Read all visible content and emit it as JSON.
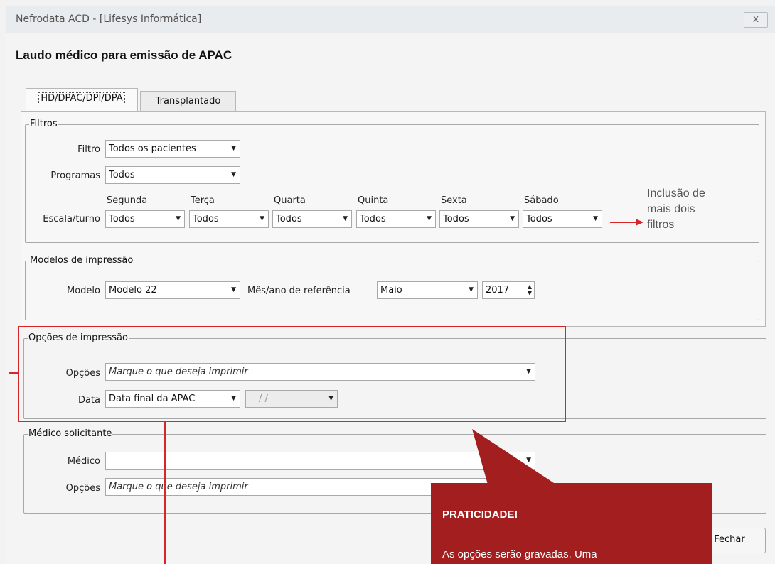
{
  "window": {
    "title": "Nefrodata ACD - [Lifesys Informática]",
    "close_glyph": "x"
  },
  "page_title": "Laudo médico para emissão de APAC",
  "tabs": [
    {
      "label": "HD/DPAC/DPI/DPA",
      "active": true
    },
    {
      "label": "Transplantado",
      "active": false
    }
  ],
  "filtros": {
    "legend": "Filtros",
    "filtro_label": "Filtro",
    "filtro_value": "Todos os pacientes",
    "programas_label": "Programas",
    "programas_value": "Todos",
    "escala_label": "Escala/turno",
    "days": [
      {
        "label": "Segunda",
        "value": "Todos"
      },
      {
        "label": "Terça",
        "value": "Todos"
      },
      {
        "label": "Quarta",
        "value": "Todos"
      },
      {
        "label": "Quinta",
        "value": "Todos"
      },
      {
        "label": "Sexta",
        "value": "Todos"
      },
      {
        "label": "Sábado",
        "value": "Todos"
      }
    ]
  },
  "modelos": {
    "legend": "Modelos de impressão",
    "modelo_label": "Modelo",
    "modelo_value": "Modelo 22",
    "mes_ano_label": "Mês/ano de referência",
    "mes_value": "Maio",
    "ano_value": "2017"
  },
  "opcoes_impressao": {
    "legend": "Opções de impressão",
    "opcoes_label": "Opções",
    "opcoes_placeholder": "Marque o que deseja imprimir",
    "data_label": "Data",
    "data_value": "Data final da APAC",
    "date_value": "/ /"
  },
  "medico_solicitante": {
    "legend": "Médico solicitante",
    "medico_label": "Médico",
    "medico_value": "",
    "opcoes_label": "Opções",
    "opcoes_placeholder": "Marque o que deseja imprimir"
  },
  "annotation": {
    "text_lines": [
      "Inclusão de",
      "mais dois",
      "filtros"
    ],
    "color": "#d9252a"
  },
  "callout": {
    "title": "PRATICIDADE!",
    "body": "As opções serão gravadas. Uma",
    "color": "#a31e1e"
  },
  "buttons": {
    "fechar": "Fechar"
  }
}
